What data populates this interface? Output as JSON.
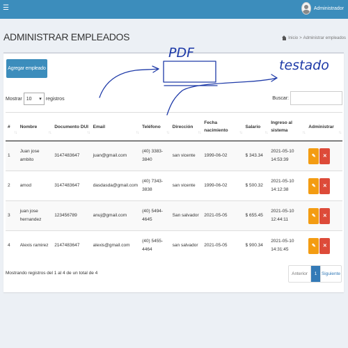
{
  "topbar": {
    "menu_icon": "hamburger-icon",
    "user_name": "Administrador",
    "avatar_icon": "user-avatar-icon"
  },
  "page": {
    "title": "ADMINISTRAR EMPLEADOS",
    "breadcrumb": {
      "home": "Inicio",
      "sep": ">",
      "current": "Administrar empleados"
    }
  },
  "toolbar": {
    "add_button": "Agregar empleado"
  },
  "table_controls": {
    "length_prefix": "Mostrar",
    "length_value": "10",
    "length_suffix": "registros",
    "search_label": "Buscar:"
  },
  "table": {
    "headers": [
      "#",
      "Nombre",
      "Documento DUI",
      "Email",
      "Teléfono",
      "Dirección",
      "Fecha nacimiento",
      "Salario",
      "Ingreso al sistema",
      "Administrar"
    ],
    "rows": [
      {
        "num": "1",
        "nombre": "Juan jose ambito",
        "dui": "3147483647",
        "email": "juan@gmail.com",
        "telefono": "(40) 3383-3840",
        "direccion": "san vicente",
        "fecha_nac": "1999-06-02",
        "salario": "$ 343.34",
        "ingreso": "2021-05-10 14:53:39"
      },
      {
        "num": "2",
        "nombre": "amod",
        "dui": "3147483647",
        "email": "dasdasda@gmail.com",
        "telefono": "(40) 7343-3838",
        "direccion": "san vicente",
        "fecha_nac": "1999-06-02",
        "salario": "$ 500.32",
        "ingreso": "2021-05-10 14:12:38"
      },
      {
        "num": "3",
        "nombre": "juan jose hernandez",
        "dui": "123456789",
        "email": "anuj@gmail.com",
        "telefono": "(40) 5494-4645",
        "direccion": "San salvador",
        "fecha_nac": "2021-05-05",
        "salario": "$ 655.45",
        "ingreso": "2021-05-10 12:44:11"
      },
      {
        "num": "4",
        "nombre": "Alexis ramirez",
        "dui": "2147483647",
        "email": "alexis@gmail.com",
        "telefono": "(40) 5455-4464",
        "direccion": "san salvador",
        "fecha_nac": "2021-05-05",
        "salario": "$ 900.34",
        "ingreso": "2021-05-10 14:31:45"
      }
    ],
    "edit_icon": "pencil-icon",
    "delete_icon": "times-icon",
    "edit_glyph": "✎",
    "delete_glyph": "✕"
  },
  "footer": {
    "info": "Mostrando registros del 1 al 4 de un total de 4",
    "prev": "Anterior",
    "page": "1",
    "next": "Siguiente"
  },
  "annotations": {
    "pdf": "PDF",
    "estado": "testado"
  }
}
